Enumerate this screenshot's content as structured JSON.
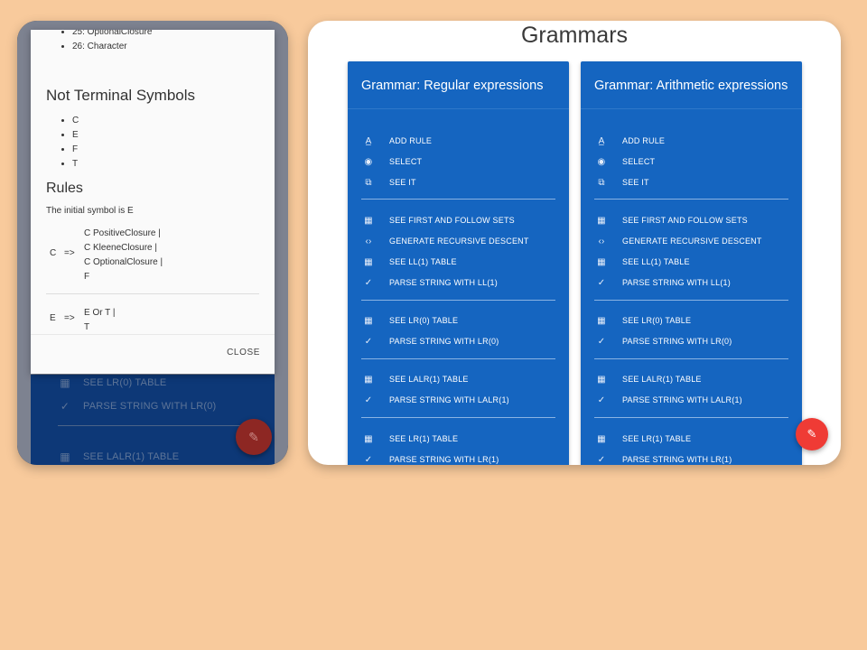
{
  "left_screen": {
    "dialog": {
      "top_list": [
        "25: OptionalClosure",
        "26: Character"
      ],
      "nts_title": "Not Terminal Symbols",
      "nts_items": [
        "C",
        "E",
        "F",
        "T"
      ],
      "rules_title": "Rules",
      "initial_symbol": "The initial symbol is E",
      "rules": [
        {
          "lhs": "C",
          "arrow": "=>",
          "rhs": [
            "C PositiveClosure |",
            "C KleeneClosure |",
            "C OptionalClosure |",
            "F"
          ]
        },
        {
          "lhs": "E",
          "arrow": "=>",
          "rhs": [
            "E Or T |",
            "T"
          ]
        }
      ],
      "close_label": "CLOSE"
    },
    "background_menu": {
      "items": [
        "SEE LR(0) TABLE",
        "PARSE STRING WITH LR(0)",
        "SEE LALR(1) TABLE"
      ]
    },
    "fab_icon": "pencil-icon"
  },
  "right_screen": {
    "title": "Grammars",
    "cards": [
      {
        "title": "Grammar: Regular expressions",
        "items": [
          "ADD RULE",
          "SELECT",
          "SEE IT",
          "SEE FIRST AND FOLLOW SETS",
          "GENERATE RECURSIVE DESCENT",
          "SEE LL(1) TABLE",
          "PARSE STRING WITH LL(1)",
          "SEE LR(0) TABLE",
          "PARSE STRING WITH LR(0)",
          "SEE LALR(1) TABLE",
          "PARSE STRING WITH LALR(1)",
          "SEE LR(1) TABLE",
          "PARSE STRING WITH LR(1)"
        ]
      },
      {
        "title": "Grammar: Arithmetic expressions",
        "items": [
          "ADD RULE",
          "SELECT",
          "SEE IT",
          "SEE FIRST AND FOLLOW SETS",
          "GENERATE RECURSIVE DESCENT",
          "SEE LL(1) TABLE",
          "PARSE STRING WITH LL(1)",
          "SEE LR(0) TABLE",
          "PARSE STRING WITH LR(0)",
          "SEE LALR(1) TABLE",
          "PARSE STRING WITH LALR(1)",
          "SEE LR(1) TABLE",
          "PARSE STRING WITH LR(1)"
        ]
      }
    ],
    "fab_icon": "pencil-icon"
  },
  "colors": {
    "background": "#f8ca9c",
    "card": "#1565c0",
    "fab_right": "#ef3b35",
    "fab_left": "#8d2723",
    "dark_menu": "#0d3877"
  }
}
